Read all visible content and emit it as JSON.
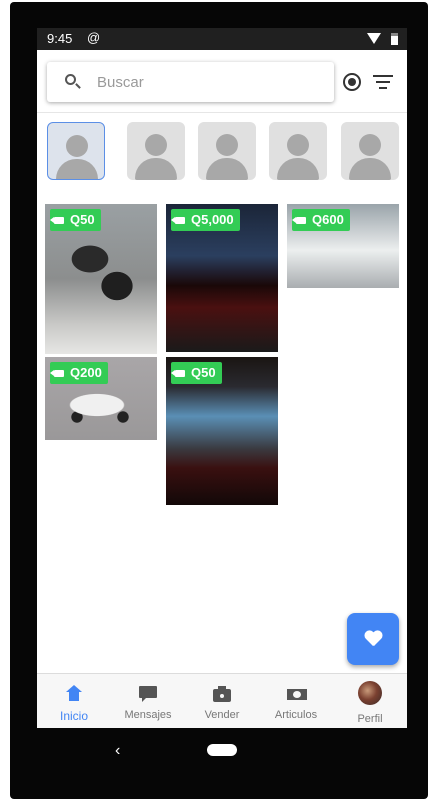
{
  "status": {
    "time": "9:45",
    "cast_icon": "cast-icon",
    "wifi_icon": "wifi-icon",
    "battery_icon": "battery-icon"
  },
  "search": {
    "placeholder": "Buscar",
    "icon": "search-icon"
  },
  "toolbar": {
    "location_icon": "location-icon",
    "filter_icon": "filter-icon"
  },
  "thumbnails": [
    {
      "icon": "person-placeholder-icon",
      "selected": true
    },
    {
      "icon": "person-placeholder-icon",
      "selected": false
    },
    {
      "icon": "person-placeholder-icon",
      "selected": false
    },
    {
      "icon": "person-placeholder-icon",
      "selected": false
    },
    {
      "icon": "person-placeholder-icon",
      "selected": false
    }
  ],
  "listings": [
    {
      "price": "Q50",
      "image": "headphones"
    },
    {
      "price": "Q5,000",
      "image": "gaming-laptop"
    },
    {
      "price": "Q600",
      "image": "metal-part"
    },
    {
      "price": "Q200",
      "image": "toy-car"
    },
    {
      "price": "Q50",
      "image": "laptop-screen"
    }
  ],
  "fab": {
    "icon": "heart-icon"
  },
  "bottom_nav": [
    {
      "label": "Inicio",
      "icon": "home-icon",
      "active": true
    },
    {
      "label": "Mensajes",
      "icon": "chat-icon",
      "active": false
    },
    {
      "label": "Vender",
      "icon": "camera-icon",
      "active": false
    },
    {
      "label": "Articulos",
      "icon": "money-icon",
      "active": false
    },
    {
      "label": "Perfil",
      "icon": "avatar",
      "active": false
    }
  ],
  "system_nav": {
    "back": "‹"
  },
  "colors": {
    "accent": "#4285f4",
    "price_tag": "#33cc55",
    "status_bar": "#202020"
  }
}
